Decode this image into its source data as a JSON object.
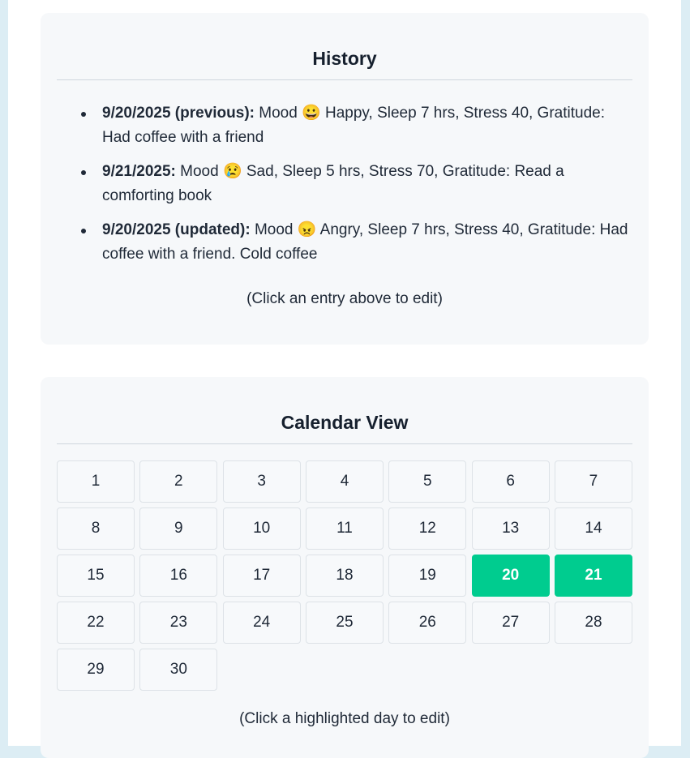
{
  "history": {
    "title": "History",
    "entries": [
      {
        "date": "9/20/2025 (previous):",
        "text": " Mood 😀 Happy, Sleep 7 hrs, Stress 40, Gratitude: Had coffee with a friend"
      },
      {
        "date": "9/21/2025:",
        "text": " Mood 😢 Sad, Sleep 5 hrs, Stress 70, Gratitude: Read a comforting book"
      },
      {
        "date": "9/20/2025 (updated):",
        "text": " Mood 😠 Angry, Sleep 7 hrs, Stress 40, Gratitude: Had coffee with a friend. Cold coffee"
      }
    ],
    "hint": "(Click an entry above to edit)"
  },
  "calendar": {
    "title": "Calendar View",
    "days": [
      "1",
      "2",
      "3",
      "4",
      "5",
      "6",
      "7",
      "8",
      "9",
      "10",
      "11",
      "12",
      "13",
      "14",
      "15",
      "16",
      "17",
      "18",
      "19",
      "20",
      "21",
      "22",
      "23",
      "24",
      "25",
      "26",
      "27",
      "28",
      "29",
      "30"
    ],
    "highlighted_days": [
      "20",
      "21"
    ],
    "highlight_color": "#00cc8f",
    "hint": "(Click a highlighted day to edit)"
  }
}
